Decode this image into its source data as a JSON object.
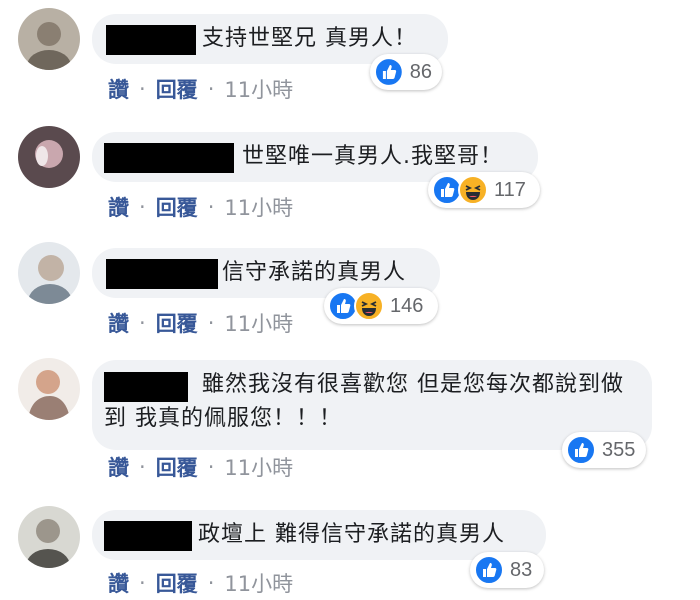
{
  "ui": {
    "like_label": "讚",
    "reply_label": "回覆",
    "separator": "·",
    "colors": {
      "like_blue": "#1877f2",
      "haha_yellow": "#f7b125",
      "bubble_bg": "#f0f2f5",
      "action_blue": "#385898",
      "meta_gray": "#90949c"
    }
  },
  "comments": [
    {
      "text": "支持世堅兄 真男人！",
      "reactions": [
        "like"
      ],
      "count": "86",
      "time": "11小時"
    },
    {
      "text": "世堅唯一真男人.我堅哥！",
      "reactions": [
        "like",
        "haha"
      ],
      "count": "117",
      "time": "11小時"
    },
    {
      "text": "信守承諾的真男人",
      "reactions": [
        "like",
        "haha"
      ],
      "count": "146",
      "time": "11小時"
    },
    {
      "text": "雖然我沒有很喜歡您 但是您每次都說到做到 我真的佩服您！！！",
      "reactions": [
        "like"
      ],
      "count": "355",
      "time": "11小時"
    },
    {
      "text": "政壇上 難得信守承諾的真男人",
      "reactions": [
        "like"
      ],
      "count": "83",
      "time": "11小時"
    }
  ]
}
